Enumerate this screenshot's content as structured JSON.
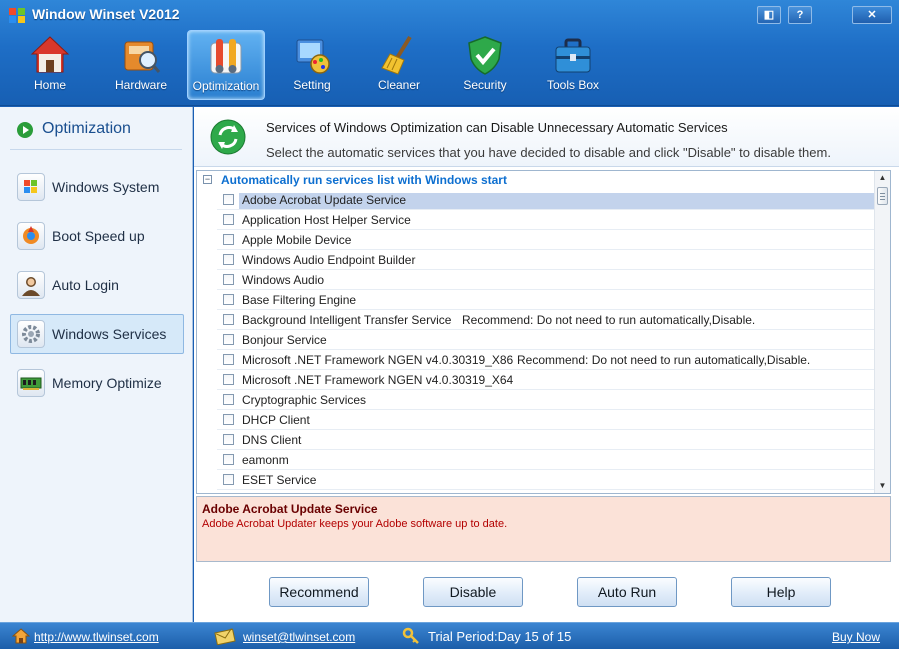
{
  "app": {
    "title": "Window Winset V2012",
    "window_buttons": {
      "skin": "◧",
      "help": "?",
      "close": "✕"
    }
  },
  "toolbar": {
    "items": [
      {
        "label": "Home",
        "icon": "home-icon"
      },
      {
        "label": "Hardware",
        "icon": "hardware-icon"
      },
      {
        "label": "Optimization",
        "icon": "optimization-icon",
        "active": true
      },
      {
        "label": "Setting",
        "icon": "setting-icon"
      },
      {
        "label": "Cleaner",
        "icon": "broom-icon"
      },
      {
        "label": "Security",
        "icon": "shield-icon"
      },
      {
        "label": "Tools Box",
        "icon": "toolbox-icon"
      }
    ]
  },
  "sidebar": {
    "heading": "Optimization",
    "items": [
      {
        "label": "Windows System",
        "icon": "windows-icon"
      },
      {
        "label": "Boot Speed up",
        "icon": "boot-icon"
      },
      {
        "label": "Auto Login",
        "icon": "user-icon"
      },
      {
        "label": "Windows Services",
        "icon": "gear-icon",
        "active": true
      },
      {
        "label": "Memory Optimize",
        "icon": "memory-icon"
      }
    ]
  },
  "header": {
    "title": "Services of Windows Optimization can Disable Unnecessary Automatic Services",
    "subtitle": "Select the automatic services that you have decided to disable and click \"Disable\" to disable them."
  },
  "services": {
    "group_toggle": "−",
    "group_label": "Automatically run services list with Windows start",
    "rows": [
      {
        "name": "Adobe Acrobat Update Service",
        "selected": true,
        "recommend": ""
      },
      {
        "name": "Application Host Helper Service",
        "recommend": ""
      },
      {
        "name": "Apple Mobile Device",
        "recommend": ""
      },
      {
        "name": "Windows Audio Endpoint Builder",
        "recommend": ""
      },
      {
        "name": "Windows Audio",
        "recommend": ""
      },
      {
        "name": "Base Filtering Engine",
        "recommend": ""
      },
      {
        "name": "Background Intelligent Transfer Service",
        "recommend": "Recommend: Do not need to run automatically,Disable."
      },
      {
        "name": "Bonjour Service",
        "recommend": ""
      },
      {
        "name": "Microsoft .NET Framework NGEN v4.0.30319_X86",
        "recommend": "Recommend: Do not need to run automatically,Disable."
      },
      {
        "name": "Microsoft .NET Framework NGEN v4.0.30319_X64",
        "recommend": ""
      },
      {
        "name": "Cryptographic Services",
        "recommend": ""
      },
      {
        "name": "DHCP Client",
        "recommend": ""
      },
      {
        "name": "DNS Client",
        "recommend": ""
      },
      {
        "name": "eamonm",
        "recommend": ""
      },
      {
        "name": "ESET Service",
        "recommend": ""
      }
    ]
  },
  "description": {
    "title": "Adobe Acrobat Update Service",
    "text": "Adobe Acrobat Updater keeps your Adobe software up to date."
  },
  "buttons": {
    "recommend": "Recommend",
    "disable": "Disable",
    "auto_run": "Auto Run",
    "help": "Help"
  },
  "status": {
    "website": "http://www.tlwinset.com",
    "email": "winset@tlwinset.com",
    "trial": "Trial Period:Day 15 of 15",
    "buy": "Buy Now"
  }
}
